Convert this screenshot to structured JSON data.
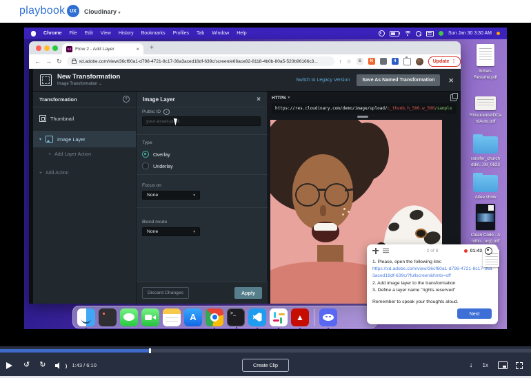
{
  "colors": {
    "brand_blue": "#2f6fd3",
    "menubar_purple": "#3b22bd",
    "xd_link_blue": "#5fa9d8",
    "radio_teal": "#3db9ac",
    "update_red": "#d93025",
    "task_link_blue": "#4a7de0",
    "next_button_blue": "#3d6fd6",
    "progress_blue": "#3e6bc9",
    "url_transform_red": "#e2574c",
    "url_asset_green": "#83c167"
  },
  "app_header": {
    "logo_text": "playbook",
    "logo_badge": "UX",
    "org_name": "Cloudinary",
    "caret": "▾"
  },
  "menubar": {
    "items": [
      "Chrome",
      "File",
      "Edit",
      "View",
      "History",
      "Bookmarks",
      "Profiles",
      "Tab",
      "Window",
      "Help"
    ],
    "clock": "Sun Jan 30 3:30 AM"
  },
  "chrome": {
    "tab_title": "Flow 2 - Add Layer",
    "tab_close": "×",
    "new_tab": "+",
    "favicon": "Xd",
    "back": "←",
    "forward": "→",
    "reload": "↻",
    "share": "↑",
    "bookmark_star": "☆",
    "url": "xd.adobe.com/view/36cf60a1-d798-4721-8c17-36a3aced18df-639c/screen/e66ace82-8118-4b0b-80a5-520b96166c3...",
    "ext_s": "S",
    "ext_n": "N",
    "ext_4": "4",
    "update_label": "Update",
    "menu_dots": "⋮"
  },
  "xd": {
    "header": {
      "title": "New Transformation",
      "subtitle": "Image Transformation",
      "subtitle_caret": "⌄",
      "legacy_link": "Switch to Legacy Version",
      "save_button": "Save As Named Transformation",
      "close": "×"
    },
    "sidebar": {
      "title": "Transformation",
      "help": "?",
      "thumbnail": "Thumbnail",
      "image_layer_caret": "▾",
      "image_layer": "Image Layer",
      "plus": "+",
      "add_layer_action": "Add Layer Action",
      "add_action": "Add Action"
    },
    "layer_panel": {
      "title": "Image Layer",
      "close": "×",
      "public_id_label": "Public ID",
      "info": "i",
      "public_id_placeholder": "your-asset-publi",
      "type_label": "Type",
      "overlay_label": "Overlay",
      "underlay_label": "Underlay",
      "focus_label": "Focus on",
      "focus_value": "None",
      "blend_label": "Blend mode",
      "blend_value": "None",
      "dropdown_caret": "▾",
      "discard_button": "Discard Changes",
      "apply_button": "Apply"
    },
    "preview": {
      "protocol": "HTTPS",
      "protocol_caret": "▾",
      "url_base": "https://res.cloudinary.com/demo/image/upload/",
      "url_transform": "c_thumb,h_500,w_500",
      "url_asset": "/sample"
    }
  },
  "desktop": {
    "icons": [
      {
        "label": "Itohan-\nResume.pdf",
        "kind": "pdf-document"
      },
      {
        "label": "RInsuranceIDCa\nrdAuto.pdf",
        "kind": "document"
      },
      {
        "label": "ransfer_church\nddin...08_0623",
        "kind": "folder"
      },
      {
        "label": "Aitee show",
        "kind": "folder"
      },
      {
        "label": "Clean Code - A\nndbo...org).pdf",
        "kind": "book"
      }
    ]
  },
  "task_panel": {
    "step_counter": "2 of 8",
    "timer": "01:43",
    "line1": "1. Please, open the following link:",
    "link": "https://xd.adobe.com/view/36cf60a1-d798-4721-8c17-36a3aced18df-639c/?fullscreen&hints=off",
    "line2": "2. Add image layer to the transformation",
    "line3": "3. Define a layer name \"rights-reserved\"",
    "reminder": "Remember to speak your thoughts aloud.",
    "next_button": "Next"
  },
  "player": {
    "time_display": "1:43 / 6:10",
    "create_clip": "Create Clip",
    "speed": "1x",
    "skip_back": "5",
    "skip_fwd": "5",
    "progress_pct": 28
  }
}
